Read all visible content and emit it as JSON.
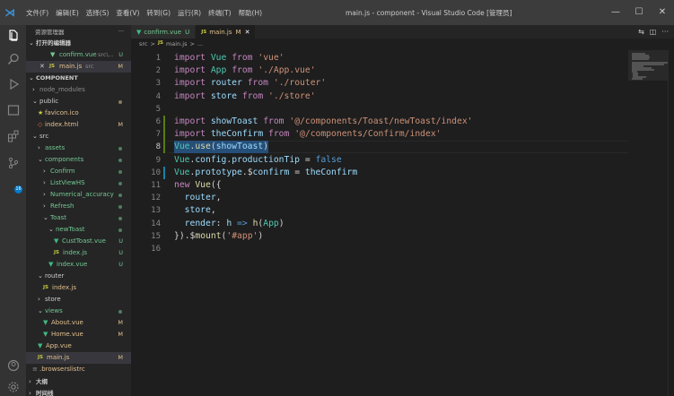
{
  "titlebar": {
    "menu": [
      "文件(F)",
      "编辑(E)",
      "选择(S)",
      "查看(V)",
      "转到(G)",
      "运行(R)",
      "终端(T)",
      "帮助(H)"
    ],
    "title": "main.js - component - Visual Studio Code [管理员]",
    "minimize": "—",
    "maximize": "☐",
    "close": "✕"
  },
  "sidebar": {
    "explorer_title": "资源管理器",
    "explorer_more": "···",
    "open_editors_title": "打开的编辑器",
    "open_editors": [
      {
        "name": "confirm.vue",
        "path": "src\\...",
        "status": "U",
        "icon": "vue-icon"
      },
      {
        "name": "main.js",
        "path": "src",
        "status": "M",
        "icon": "js-icon"
      }
    ],
    "project_title": "COMPONENT",
    "tree": [
      {
        "name": "node_modules",
        "kind": "folder",
        "open": false
      },
      {
        "name": "public",
        "kind": "folder",
        "open": true
      },
      {
        "name": "favicon.ico",
        "kind": "file"
      },
      {
        "name": "index.html",
        "kind": "file",
        "status": "M"
      },
      {
        "name": "src",
        "kind": "folder",
        "open": true
      },
      {
        "name": "assets",
        "kind": "folder",
        "open": false
      },
      {
        "name": "components",
        "kind": "folder",
        "open": true
      },
      {
        "name": "Confirm",
        "kind": "folder",
        "open": false
      },
      {
        "name": "ListViewHS",
        "kind": "folder",
        "open": false
      },
      {
        "name": "Numerical_accuracy",
        "kind": "folder",
        "open": false
      },
      {
        "name": "Refresh",
        "kind": "folder",
        "open": false
      },
      {
        "name": "Toast",
        "kind": "folder",
        "open": true
      },
      {
        "name": "newToast",
        "kind": "folder",
        "open": true
      },
      {
        "name": "CustToast.vue",
        "kind": "file",
        "status": "U"
      },
      {
        "name": "index.js",
        "kind": "file",
        "status": "U"
      },
      {
        "name": "index.vue",
        "kind": "file",
        "status": "U"
      },
      {
        "name": "router",
        "kind": "folder",
        "open": true
      },
      {
        "name": "index.js",
        "kind": "file"
      },
      {
        "name": "store",
        "kind": "folder",
        "open": false
      },
      {
        "name": "views",
        "kind": "folder",
        "open": true
      },
      {
        "name": "About.vue",
        "kind": "file",
        "status": "M"
      },
      {
        "name": "Home.vue",
        "kind": "file",
        "status": "M"
      },
      {
        "name": "App.vue",
        "kind": "file"
      },
      {
        "name": "main.js",
        "kind": "file",
        "status": "M"
      },
      {
        "name": ".browserslistrc",
        "kind": "file"
      }
    ],
    "outline_title": "大纲",
    "timeline_title": "时间线"
  },
  "tabs": [
    {
      "name": "confirm.vue",
      "status": "U",
      "active": false
    },
    {
      "name": "main.js",
      "status": "M",
      "active": true
    }
  ],
  "tab_actions": {
    "compare": "⇆",
    "split": "◫",
    "more": "···"
  },
  "breadcrumb": {
    "folder": "src",
    "sep": ">",
    "file": "main.js",
    "more": "..."
  },
  "editor": {
    "current_line": 8,
    "lines": [
      "import Vue from 'vue'",
      "import App from './App.vue'",
      "import router from './router'",
      "import store from './store'",
      "",
      "import showToast from '@/components/Toast/newToast/index'",
      "import theConfirm from '@/components/Confirm/index'",
      "Vue.use(showToast)",
      "Vue.config.productionTip = false",
      "Vue.prototype.$confirm = theConfirm",
      "new Vue({",
      "  router,",
      "  store,",
      "  render: h => h(App)",
      "}).$mount('#app')",
      ""
    ]
  },
  "colors": {
    "accent": "#007acc",
    "untracked": "#73c991",
    "modified": "#e2c08d",
    "keyword": "#c586c0",
    "string": "#ce9178",
    "variable": "#9cdcfe",
    "function": "#dcdcaa"
  }
}
